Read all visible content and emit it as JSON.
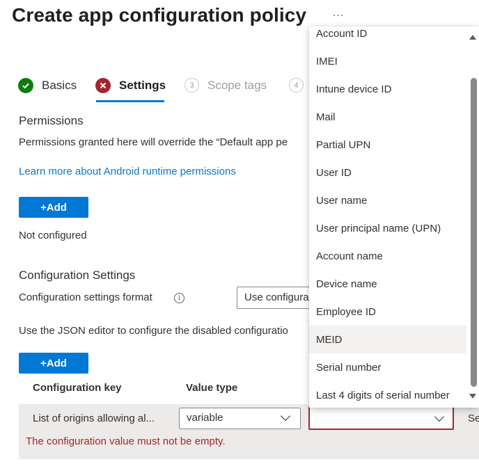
{
  "header": {
    "title": "Create app configuration policy",
    "more_glyph": "..."
  },
  "wizard": {
    "steps": [
      {
        "label": "Basics",
        "state": "complete",
        "icon": "check-circle-icon",
        "glyph": "✓"
      },
      {
        "label": "Settings",
        "state": "error",
        "icon": "error-circle-icon",
        "glyph": "✕"
      },
      {
        "label": "Scope tags",
        "state": "upcoming",
        "number": "3"
      },
      {
        "label": "",
        "state": "upcoming",
        "number": "4"
      }
    ]
  },
  "permissions": {
    "title": "Permissions",
    "description": "Permissions granted here will override the “Default app pe",
    "learn_more": "Learn more about Android runtime permissions",
    "add_label": "+Add",
    "status": "Not configured"
  },
  "config": {
    "title": "Configuration Settings",
    "format_label": "Configuration settings format",
    "format_value": "Use configura",
    "json_note": "Use the JSON editor to configure the disabled configuratio",
    "add_label": "+Add",
    "columns": [
      "Configuration key",
      "Value type"
    ],
    "row": {
      "key": "List of origins allowing al...",
      "value_type": "variable",
      "value": "",
      "trailing": "Se"
    },
    "error": "The configuration value must not be empty."
  },
  "dropdown": {
    "options": [
      "Account ID",
      "IMEI",
      "Intune device ID",
      "Mail",
      "Partial UPN",
      "User ID",
      "User name",
      "User principal name (UPN)",
      "Account name",
      "Device name",
      "Employee ID",
      "MEID",
      "Serial number",
      "Last 4 digits of serial number"
    ],
    "hovered": "MEID"
  },
  "colors": {
    "accent": "#0078d4",
    "success": "#107c10",
    "error": "#a4262c"
  }
}
